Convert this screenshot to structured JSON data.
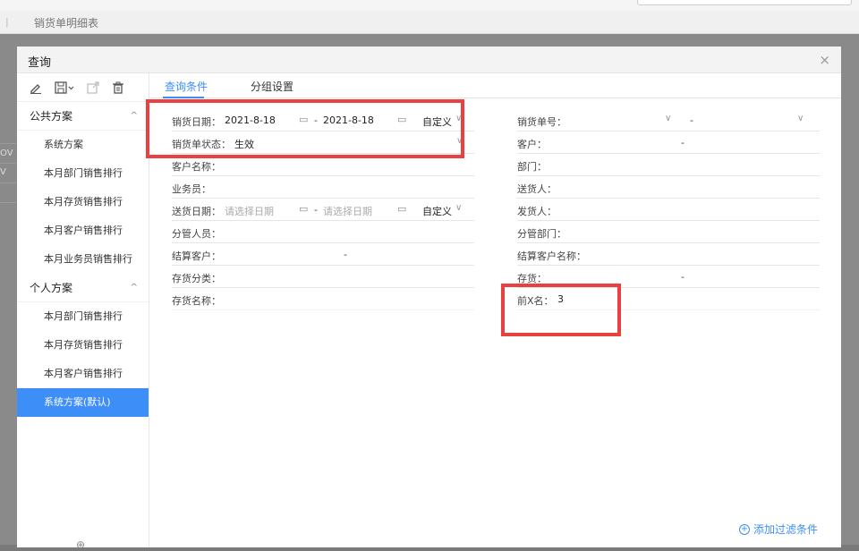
{
  "background": {
    "tab_title": "销货单明细表",
    "row_labels": [
      "OV",
      "V"
    ]
  },
  "modal": {
    "title": "查询",
    "close": "×"
  },
  "sidebar": {
    "public_group": "公共方案",
    "public_items": [
      "系统方案",
      "本月部门销售排行",
      "本月存货销售排行",
      "本月客户销售排行",
      "本月业务员销售排行"
    ],
    "personal_group": "个人方案",
    "personal_items": [
      "本月部门销售排行",
      "本月存货销售排行",
      "本月客户销售排行",
      "系统方案(默认)"
    ]
  },
  "tabs": {
    "query": "查询条件",
    "group": "分组设置"
  },
  "left_fields": {
    "sale_date_label": "销货日期：",
    "sale_date_from": "2021-8-18",
    "sale_date_to": "2021-8-18",
    "custom": "自定义",
    "status_label": "销货单状态：",
    "status_value": "生效",
    "customer_name_label": "客户名称：",
    "salesman_label": "业务员：",
    "delivery_date_label": "送货日期：",
    "date_placeholder": "请选择日期",
    "manager_label": "分管人员：",
    "settle_customer_label": "结算客户：",
    "inventory_class_label": "存货分类：",
    "inventory_name_label": "存货名称："
  },
  "right_fields": {
    "order_no_label": "销货单号：",
    "customer_label": "客户：",
    "dept_label": "部门：",
    "deliverer_label": "送货人：",
    "shipper_label": "发货人：",
    "manage_dept_label": "分管部门：",
    "settle_customer_name_label": "结算客户名称：",
    "inventory_label": "存货：",
    "top_x_label": "前X名：",
    "top_x_value": "3"
  },
  "dash": "-",
  "add_filter": "添加过滤条件",
  "colors": {
    "accent": "#3e8ef7",
    "highlight": "#e8413f"
  }
}
